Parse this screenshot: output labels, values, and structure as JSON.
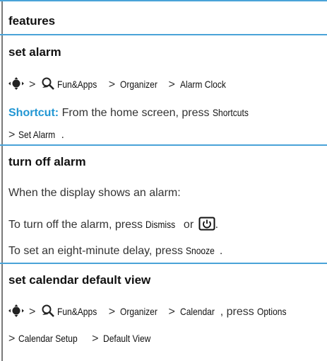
{
  "colors": {
    "accent": "#2196d3",
    "rule": "#4aa3d8",
    "border": "#7a7a7a"
  },
  "section_title": "features",
  "set_alarm": {
    "heading": "set alarm",
    "path": [
      "Fun&Apps",
      "Organizer",
      "Alarm Clock"
    ],
    "shortcut_label": "Shortcut:",
    "shortcut_text": "From the home screen, press",
    "shortcut_key1": "Shortcuts",
    "shortcut_key2": "Set Alarm",
    "shortcut_end": "."
  },
  "turn_off_alarm": {
    "heading": "turn off alarm",
    "line1": "When the display shows an alarm:",
    "line2_pre": "To turn off the alarm, press",
    "line2_key": "Dismiss",
    "line2_or": "or",
    "line2_end": ".",
    "line3_pre": "To set an eight-minute delay, press",
    "line3_key": "Snooze",
    "line3_end": "."
  },
  "calendar_view": {
    "heading": "set calendar default view",
    "path": [
      "Fun&Apps",
      "Organizer",
      "Calendar"
    ],
    "press_text": ", press",
    "press_key": "Options",
    "path2": [
      "Calendar Setup",
      "Default View"
    ]
  },
  "icons": {
    "nav": "nav-key-icon",
    "apps": "fun-apps-icon",
    "button": "power-end-key-icon"
  },
  "symbols": {
    "gt": ">"
  }
}
